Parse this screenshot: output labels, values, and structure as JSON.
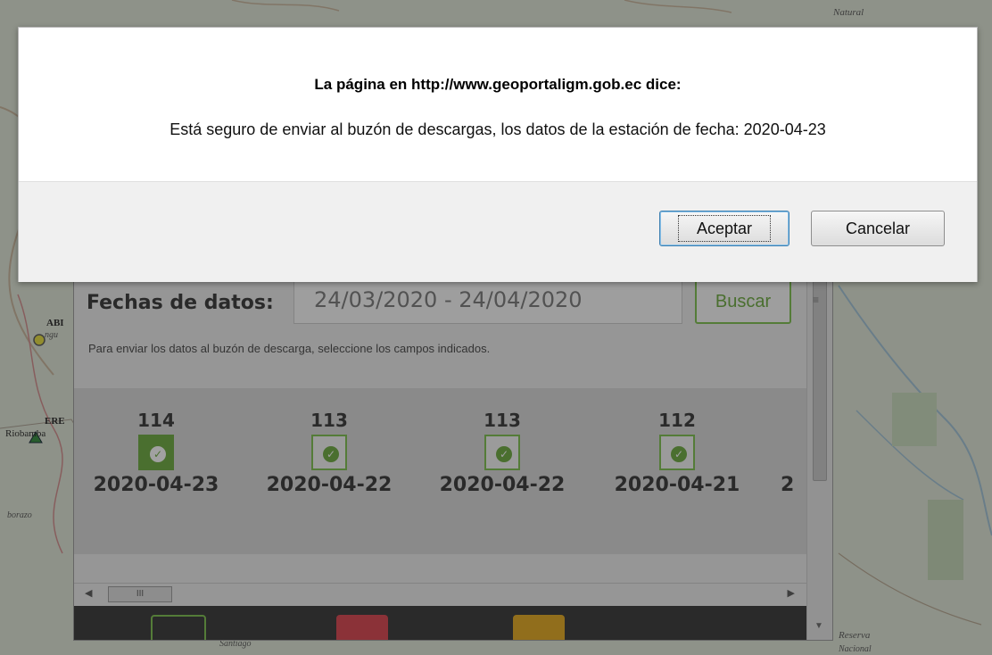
{
  "map": {
    "labels": {
      "ab": "ABI",
      "ngu": "ngu",
      "ere": "ERE",
      "riobamba": "Riobamba",
      "guano": "borazo",
      "natural": "Natural",
      "santiago": "Santiago",
      "reserva": "Reserva",
      "nacional": "Nacional"
    }
  },
  "panel": {
    "fechas_label": "Fechas de datos:",
    "date_range": "24/03/2020 - 24/04/2020",
    "buscar_label": "Buscar",
    "hint": "Para enviar los datos al buzón de descarga, seleccione los campos indicados.",
    "days": [
      {
        "count": "114",
        "date": "2020-04-23",
        "selected": true
      },
      {
        "count": "113",
        "date": "2020-04-22",
        "selected": false
      },
      {
        "count": "113",
        "date": "2020-04-22",
        "selected": false
      },
      {
        "count": "112",
        "date": "2020-04-21",
        "selected": false
      },
      {
        "count": "",
        "date": "2",
        "selected": false
      }
    ],
    "hscroll_grip": "III",
    "legend_colors": [
      "#333333",
      "#d9414a",
      "#e3a81a"
    ]
  },
  "dialog": {
    "title": "La página en http://www.geoportaligm.gob.ec dice:",
    "message": "Está seguro de enviar al buzón de descargas, los datos de la estación de fecha: 2020-04-23",
    "accept_label": "Aceptar",
    "cancel_label": "Cancelar"
  },
  "colors": {
    "accent_green": "#6aa93c",
    "dialog_bg": "#ffffff",
    "footer_bg": "#f0f0f0"
  }
}
